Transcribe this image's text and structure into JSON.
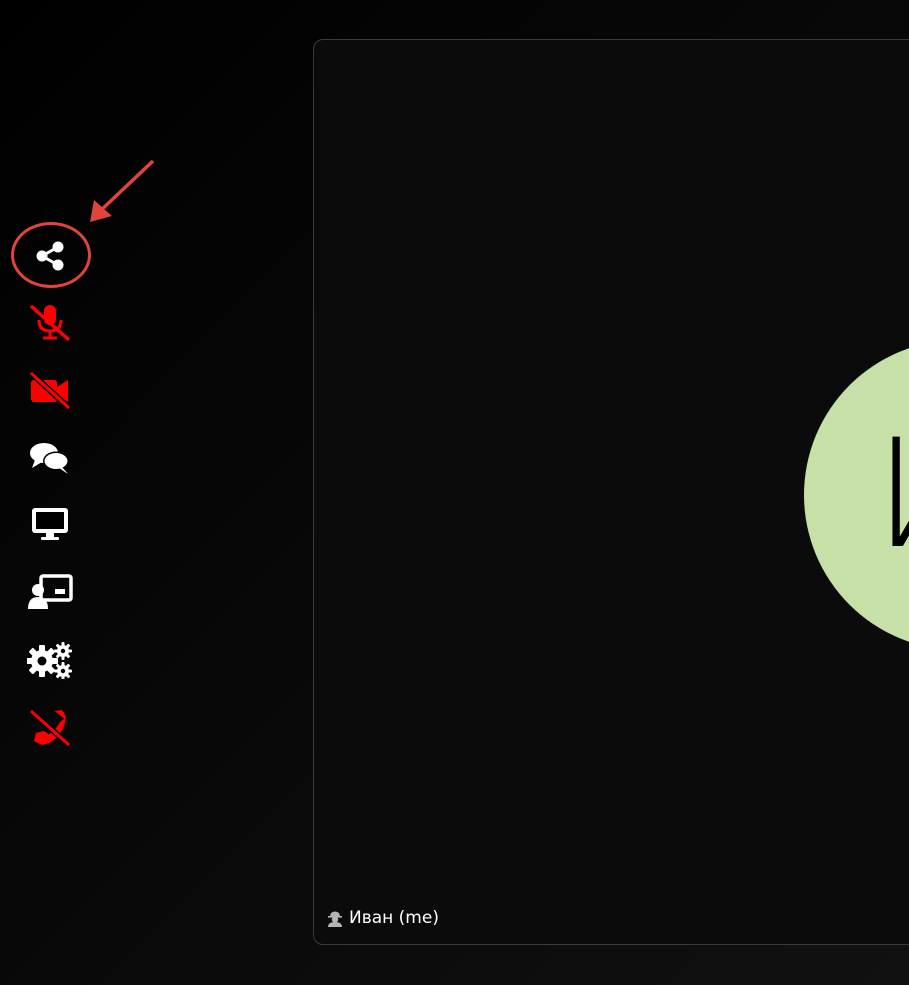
{
  "sidebar": {
    "buttons": [
      {
        "icon": "share-icon",
        "color": "#ffffff"
      },
      {
        "icon": "microphone-slash-icon",
        "color": "#ff0000"
      },
      {
        "icon": "video-slash-icon",
        "color": "#ff0000"
      },
      {
        "icon": "comments-icon",
        "color": "#ffffff"
      },
      {
        "icon": "desktop-icon",
        "color": "#ffffff"
      },
      {
        "icon": "chalkboard-user-icon",
        "color": "#ffffff"
      },
      {
        "icon": "gears-icon",
        "color": "#ffffff"
      },
      {
        "icon": "phone-slash-icon",
        "color": "#ff0000"
      }
    ]
  },
  "annotation": {
    "color": "#e0443a"
  },
  "video_tile": {
    "avatar_letter": "И",
    "avatar_color": "#c6e0a8",
    "participant_name": "Иван (me)"
  }
}
